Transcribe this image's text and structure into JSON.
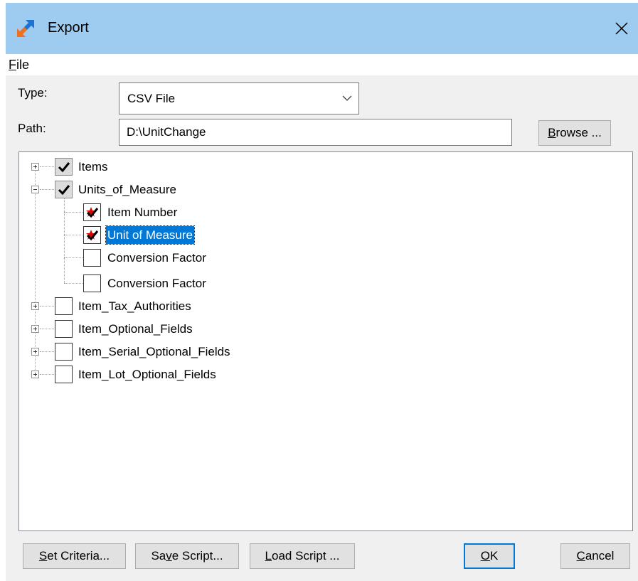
{
  "window": {
    "title": "Export",
    "close_icon": "close-icon",
    "app_icon": "export-arrows-icon"
  },
  "menu": {
    "file_accel": "F",
    "file_rest": "ile"
  },
  "form": {
    "type_label": "Type:",
    "type_value": "CSV File",
    "path_label": "Path:",
    "path_value": "D:\\UnitChange",
    "browse_accel": "B",
    "browse_rest": "rowse ..."
  },
  "tree": {
    "nodes": [
      {
        "label": "Items",
        "checked": true,
        "greyed": true,
        "expanded": false
      },
      {
        "label": "Units_of_Measure",
        "checked": true,
        "greyed": true,
        "expanded": true,
        "children": [
          {
            "label": "Item Number",
            "checked": true,
            "required": true,
            "selected": false
          },
          {
            "label": "Unit of Measure",
            "checked": true,
            "required": true,
            "selected": true
          },
          {
            "label": "Conversion Factor",
            "checked": false,
            "required": false,
            "selected": false
          },
          {
            "label": "Conversion Factor",
            "checked": false,
            "required": false,
            "selected": false
          }
        ]
      },
      {
        "label": "Item_Tax_Authorities",
        "checked": false,
        "expanded": false
      },
      {
        "label": "Item_Optional_Fields",
        "checked": false,
        "expanded": false
      },
      {
        "label": "Item_Serial_Optional_Fields",
        "checked": false,
        "expanded": false
      },
      {
        "label": "Item_Lot_Optional_Fields",
        "checked": false,
        "expanded": false
      }
    ]
  },
  "buttons": {
    "set_criteria_accel": "S",
    "set_criteria_rest": "et Criteria...",
    "save_script_pre": "Sa",
    "save_script_accel": "v",
    "save_script_rest": "e Script...",
    "load_script_accel": "L",
    "load_script_rest": "oad Script ...",
    "ok_accel": "O",
    "ok_rest": "K",
    "cancel_accel": "C",
    "cancel_rest": "ancel"
  },
  "colors": {
    "titlebar": "#9ecbf0",
    "selection": "#0078d7",
    "required_star": "#e00000"
  }
}
